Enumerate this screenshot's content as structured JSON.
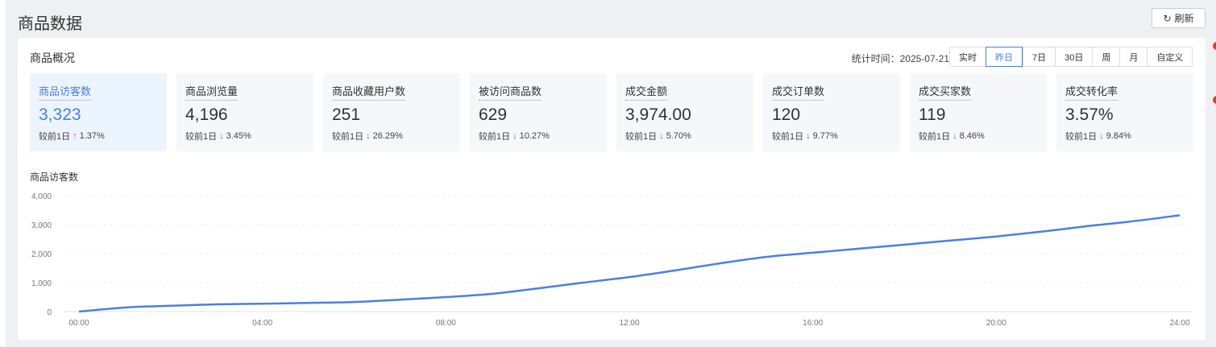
{
  "header": {
    "title": "商品数据",
    "refresh_label": "刷新",
    "refresh_icon": "refresh-icon"
  },
  "overview": {
    "title": "商品概况",
    "stat_time_label": "统计时间：2025-07-21",
    "tabs": [
      {
        "label": "实时"
      },
      {
        "label": "昨日",
        "active": true
      },
      {
        "label": "7日"
      },
      {
        "label": "30日"
      },
      {
        "label": "周"
      },
      {
        "label": "月"
      },
      {
        "label": "自定义"
      }
    ],
    "metrics": [
      {
        "label": "商品访客数",
        "value": "3,323",
        "compare": "较前1日",
        "trend": "up",
        "change": "1.37%",
        "selected": true
      },
      {
        "label": "商品浏览量",
        "value": "4,196",
        "compare": "较前1日",
        "trend": "down",
        "change": "3.45%"
      },
      {
        "label": "商品收藏用户数",
        "value": "251",
        "compare": "较前1日",
        "trend": "down",
        "change": "26.29%"
      },
      {
        "label": "被访问商品数",
        "value": "629",
        "compare": "较前1日",
        "trend": "down",
        "change": "10.27%"
      },
      {
        "label": "成交金额",
        "value": "3,974.00",
        "compare": "较前1日",
        "trend": "down",
        "change": "5.70%"
      },
      {
        "label": "成交订单数",
        "value": "120",
        "compare": "较前1日",
        "trend": "down",
        "change": "9.77%"
      },
      {
        "label": "成交买家数",
        "value": "119",
        "compare": "较前1日",
        "trend": "down",
        "change": "8.46%"
      },
      {
        "label": "成交转化率",
        "value": "3.57%",
        "compare": "较前1日",
        "trend": "down",
        "change": "9.84%"
      }
    ],
    "colors": {
      "accent": "#4a7fe6",
      "up": "#f04b4b",
      "down": "#1aa34a"
    }
  },
  "chart_data": {
    "type": "line",
    "title": "商品访客数",
    "x": [
      0,
      1,
      2,
      3,
      4,
      5,
      6,
      7,
      8,
      9,
      10,
      11,
      12,
      13,
      14,
      15,
      16,
      17,
      18,
      19,
      20,
      21,
      22,
      23,
      24
    ],
    "values": [
      0,
      140,
      200,
      250,
      270,
      300,
      330,
      410,
      500,
      610,
      800,
      1000,
      1190,
      1420,
      1670,
      1890,
      2030,
      2170,
      2310,
      2450,
      2590,
      2760,
      2950,
      3120,
      3323
    ],
    "xticks": [
      "00:00",
      "04:00",
      "08:00",
      "12:00",
      "16:00",
      "20:00",
      "24:00"
    ],
    "yticks": [
      "0",
      "1,000",
      "2,000",
      "3,000",
      "4,000"
    ],
    "ylim": [
      0,
      4000
    ],
    "xlim": [
      0,
      24
    ],
    "grid": true,
    "color": "#4a7fe6"
  }
}
